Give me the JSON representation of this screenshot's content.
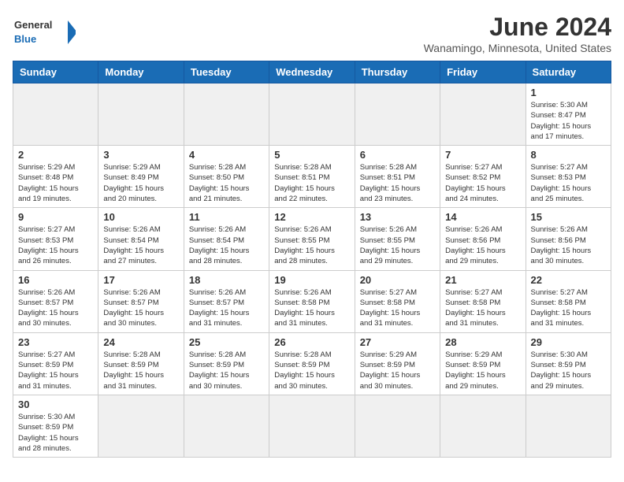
{
  "header": {
    "logo_general": "General",
    "logo_blue": "Blue",
    "title": "June 2024",
    "subtitle": "Wanamingo, Minnesota, United States"
  },
  "weekdays": [
    "Sunday",
    "Monday",
    "Tuesday",
    "Wednesday",
    "Thursday",
    "Friday",
    "Saturday"
  ],
  "days": [
    {
      "num": "",
      "info": ""
    },
    {
      "num": "",
      "info": ""
    },
    {
      "num": "",
      "info": ""
    },
    {
      "num": "",
      "info": ""
    },
    {
      "num": "",
      "info": ""
    },
    {
      "num": "",
      "info": ""
    },
    {
      "num": "1",
      "info": "Sunrise: 5:30 AM\nSunset: 8:47 PM\nDaylight: 15 hours\nand 17 minutes."
    },
    {
      "num": "2",
      "info": "Sunrise: 5:29 AM\nSunset: 8:48 PM\nDaylight: 15 hours\nand 19 minutes."
    },
    {
      "num": "3",
      "info": "Sunrise: 5:29 AM\nSunset: 8:49 PM\nDaylight: 15 hours\nand 20 minutes."
    },
    {
      "num": "4",
      "info": "Sunrise: 5:28 AM\nSunset: 8:50 PM\nDaylight: 15 hours\nand 21 minutes."
    },
    {
      "num": "5",
      "info": "Sunrise: 5:28 AM\nSunset: 8:51 PM\nDaylight: 15 hours\nand 22 minutes."
    },
    {
      "num": "6",
      "info": "Sunrise: 5:28 AM\nSunset: 8:51 PM\nDaylight: 15 hours\nand 23 minutes."
    },
    {
      "num": "7",
      "info": "Sunrise: 5:27 AM\nSunset: 8:52 PM\nDaylight: 15 hours\nand 24 minutes."
    },
    {
      "num": "8",
      "info": "Sunrise: 5:27 AM\nSunset: 8:53 PM\nDaylight: 15 hours\nand 25 minutes."
    },
    {
      "num": "9",
      "info": "Sunrise: 5:27 AM\nSunset: 8:53 PM\nDaylight: 15 hours\nand 26 minutes."
    },
    {
      "num": "10",
      "info": "Sunrise: 5:26 AM\nSunset: 8:54 PM\nDaylight: 15 hours\nand 27 minutes."
    },
    {
      "num": "11",
      "info": "Sunrise: 5:26 AM\nSunset: 8:54 PM\nDaylight: 15 hours\nand 28 minutes."
    },
    {
      "num": "12",
      "info": "Sunrise: 5:26 AM\nSunset: 8:55 PM\nDaylight: 15 hours\nand 28 minutes."
    },
    {
      "num": "13",
      "info": "Sunrise: 5:26 AM\nSunset: 8:55 PM\nDaylight: 15 hours\nand 29 minutes."
    },
    {
      "num": "14",
      "info": "Sunrise: 5:26 AM\nSunset: 8:56 PM\nDaylight: 15 hours\nand 29 minutes."
    },
    {
      "num": "15",
      "info": "Sunrise: 5:26 AM\nSunset: 8:56 PM\nDaylight: 15 hours\nand 30 minutes."
    },
    {
      "num": "16",
      "info": "Sunrise: 5:26 AM\nSunset: 8:57 PM\nDaylight: 15 hours\nand 30 minutes."
    },
    {
      "num": "17",
      "info": "Sunrise: 5:26 AM\nSunset: 8:57 PM\nDaylight: 15 hours\nand 30 minutes."
    },
    {
      "num": "18",
      "info": "Sunrise: 5:26 AM\nSunset: 8:57 PM\nDaylight: 15 hours\nand 31 minutes."
    },
    {
      "num": "19",
      "info": "Sunrise: 5:26 AM\nSunset: 8:58 PM\nDaylight: 15 hours\nand 31 minutes."
    },
    {
      "num": "20",
      "info": "Sunrise: 5:27 AM\nSunset: 8:58 PM\nDaylight: 15 hours\nand 31 minutes."
    },
    {
      "num": "21",
      "info": "Sunrise: 5:27 AM\nSunset: 8:58 PM\nDaylight: 15 hours\nand 31 minutes."
    },
    {
      "num": "22",
      "info": "Sunrise: 5:27 AM\nSunset: 8:58 PM\nDaylight: 15 hours\nand 31 minutes."
    },
    {
      "num": "23",
      "info": "Sunrise: 5:27 AM\nSunset: 8:59 PM\nDaylight: 15 hours\nand 31 minutes."
    },
    {
      "num": "24",
      "info": "Sunrise: 5:28 AM\nSunset: 8:59 PM\nDaylight: 15 hours\nand 31 minutes."
    },
    {
      "num": "25",
      "info": "Sunrise: 5:28 AM\nSunset: 8:59 PM\nDaylight: 15 hours\nand 30 minutes."
    },
    {
      "num": "26",
      "info": "Sunrise: 5:28 AM\nSunset: 8:59 PM\nDaylight: 15 hours\nand 30 minutes."
    },
    {
      "num": "27",
      "info": "Sunrise: 5:29 AM\nSunset: 8:59 PM\nDaylight: 15 hours\nand 30 minutes."
    },
    {
      "num": "28",
      "info": "Sunrise: 5:29 AM\nSunset: 8:59 PM\nDaylight: 15 hours\nand 29 minutes."
    },
    {
      "num": "29",
      "info": "Sunrise: 5:30 AM\nSunset: 8:59 PM\nDaylight: 15 hours\nand 29 minutes."
    },
    {
      "num": "30",
      "info": "Sunrise: 5:30 AM\nSunset: 8:59 PM\nDaylight: 15 hours\nand 28 minutes."
    },
    {
      "num": "",
      "info": ""
    },
    {
      "num": "",
      "info": ""
    },
    {
      "num": "",
      "info": ""
    },
    {
      "num": "",
      "info": ""
    },
    {
      "num": "",
      "info": ""
    },
    {
      "num": "",
      "info": ""
    }
  ]
}
